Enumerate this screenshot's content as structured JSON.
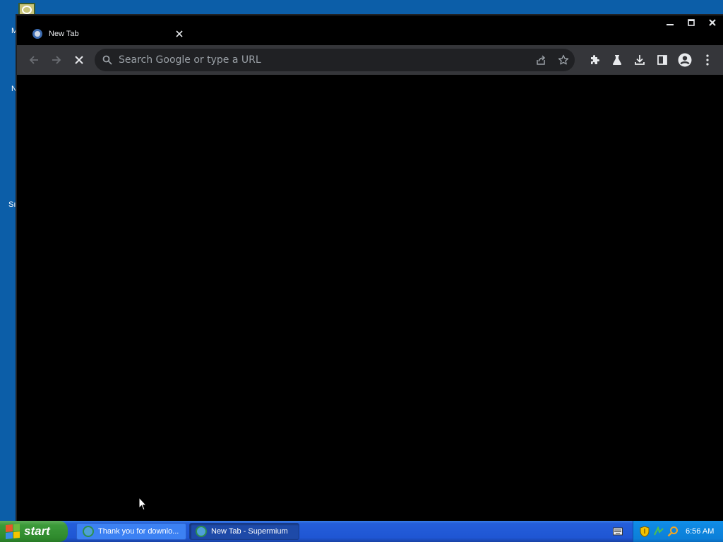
{
  "desktop": {
    "fragments": [
      "M",
      "N",
      "Sı"
    ]
  },
  "browser": {
    "tab": {
      "title": "New Tab",
      "close_icon": "close-icon"
    },
    "window_controls": {
      "minimize": "minimize-icon",
      "maximize": "maximize-icon",
      "close": "close-icon"
    },
    "toolbar": {
      "back": "back-arrow-icon",
      "forward": "forward-arrow-icon",
      "stop": "stop-loading-icon",
      "omnibox": {
        "placeholder": "Search Google or type a URL",
        "value": ""
      },
      "right_icons": [
        "share-icon",
        "bookmark-star-icon",
        "extensions-icon",
        "labs-flask-icon",
        "download-icon",
        "side-panel-icon",
        "profile-avatar-icon",
        "menu-kebab-icon"
      ]
    }
  },
  "taskbar": {
    "start_label": "start",
    "tasks": [
      {
        "label": "Thank you for downlo...",
        "active": false
      },
      {
        "label": "New Tab - Supermium",
        "active": true
      }
    ],
    "clock": "6:56 AM"
  },
  "colors": {
    "toolbar_bg": "#35363a",
    "omnibox_bg": "#202124",
    "content_bg": "#000000",
    "taskbar_blue": "#245edb",
    "start_green": "#3c9a3a",
    "tray_blue": "#0c7fd8"
  }
}
